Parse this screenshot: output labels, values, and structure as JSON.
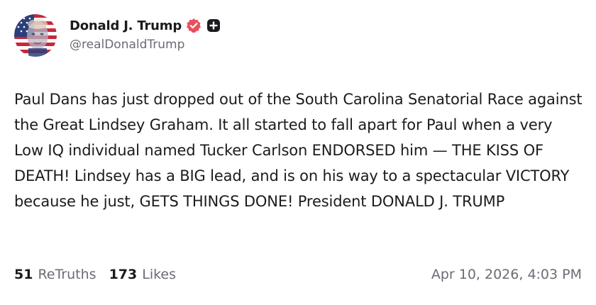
{
  "author": {
    "display_name": "Donald J. Trump",
    "handle": "@realDonaldTrump",
    "avatar_icon": "portrait-flag-avatar",
    "verified_icon": "verified-badge-icon",
    "verified_color": "#e8505b",
    "plus_icon": "plus-badge-icon"
  },
  "post": {
    "text": "Paul Dans has just dropped out of the South Carolina Senatorial Race against the Great Lindsey Graham. It all started to fall apart for Paul when a very Low IQ individual named Tucker Carlson ENDORSED him — THE KISS OF DEATH! Lindsey has a BIG lead, and is on his way to a spectacular VICTORY because he just, GETS THINGS DONE! President DONALD J. TRUMP"
  },
  "stats": {
    "retruths_count": "51",
    "retruths_label": "ReTruths",
    "likes_count": "173",
    "likes_label": "Likes"
  },
  "timestamp": "Apr 10, 2026, 4:03 PM",
  "colors": {
    "text": "#1b1b1f",
    "muted": "#6b6b76",
    "verified": "#e8505b"
  }
}
